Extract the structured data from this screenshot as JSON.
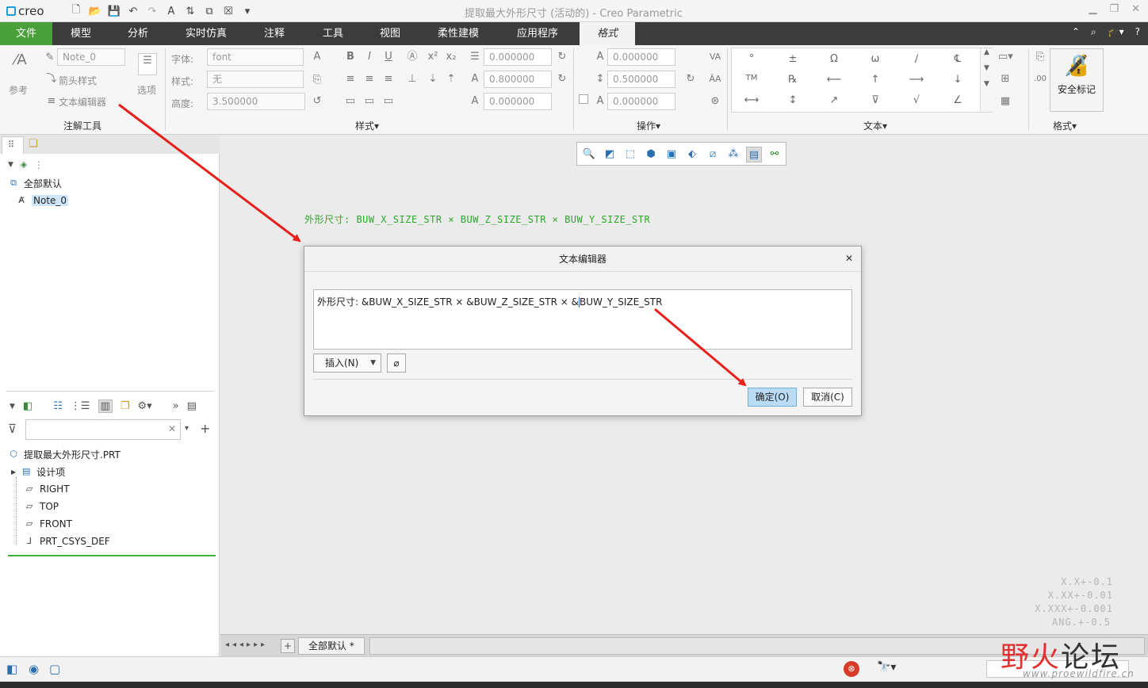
{
  "app": {
    "logo": "creo",
    "window_title": "提取最大外形尺寸 (活动的) - Creo Parametric"
  },
  "tabs": [
    {
      "label": "文件"
    },
    {
      "label": "模型"
    },
    {
      "label": "分析"
    },
    {
      "label": "实时仿真"
    },
    {
      "label": "注释"
    },
    {
      "label": "工具"
    },
    {
      "label": "视图"
    },
    {
      "label": "柔性建模"
    },
    {
      "label": "应用程序"
    },
    {
      "label": "格式"
    }
  ],
  "ribbon": {
    "annot_tools": {
      "ref_label": "参考",
      "note_value": "Note_0",
      "arrow_style": "箭头样式",
      "text_editor": "文本编辑器",
      "options_label": "选项",
      "group_label": "注解工具"
    },
    "style": {
      "font_label": "字体:",
      "font_value": "font",
      "style_label": "样式:",
      "style_value": "无",
      "height_label": "高度:",
      "height_value": "3.500000",
      "group_label": "样式"
    },
    "format_fields": [
      "0.000000",
      "0.800000",
      "0.000000"
    ],
    "ops": {
      "fields": [
        "0.000000",
        "0.500000",
        "0.000000"
      ],
      "group_label": "操作"
    },
    "text_group_label": "文本",
    "symbols": [
      "°",
      "±",
      "Ω",
      "ω",
      "∕",
      "℄",
      "TM",
      "℞",
      "⟵",
      "↑",
      "⟶",
      "↓",
      "⟷",
      "↕",
      "↗",
      "⊽",
      "√",
      "∠"
    ],
    "safety_label": "安全标记",
    "format_group_label": "格式"
  },
  "layer_tree": {
    "root": "全部默认",
    "note": "Note_0"
  },
  "model_tree": {
    "search_placeholder": "",
    "part": "提取最大外形尺寸.PRT",
    "items": [
      "设计项",
      "RIGHT",
      "TOP",
      "FRONT",
      "PRT_CSYS_DEF"
    ]
  },
  "canvas": {
    "note_text": "外形尺寸: BUW_X_SIZE_STR × BUW_Z_SIZE_STR × BUW_Y_SIZE_STR",
    "tolerances": [
      "X.X+-0.1",
      "X.XX+-0.01",
      "X.XXX+-0.001",
      "ANG.+-0.5"
    ]
  },
  "dialog": {
    "title": "文本编辑器",
    "text_before_caret": "外形尺寸:  &BUW_X_SIZE_STR × &BUW_Z_SIZE_STR × &",
    "text_after_caret": "BUW_Y_SIZE_STR",
    "insert_label": "插入(N)",
    "ok_label": "确定(O)",
    "cancel_label": "取消(C)"
  },
  "bottom": {
    "tab_label": "全部默认 *"
  },
  "watermark": {
    "text_red": "野火",
    "text_black": "论坛",
    "url": "www.proewildfire.cn"
  },
  "colors": {
    "file_tab": "#4aa03a",
    "tab_bar": "#3c3c3c",
    "note_green": "#2ba82b",
    "arrow_red": "#e8201c",
    "ok_button": "#b9dcf4"
  }
}
